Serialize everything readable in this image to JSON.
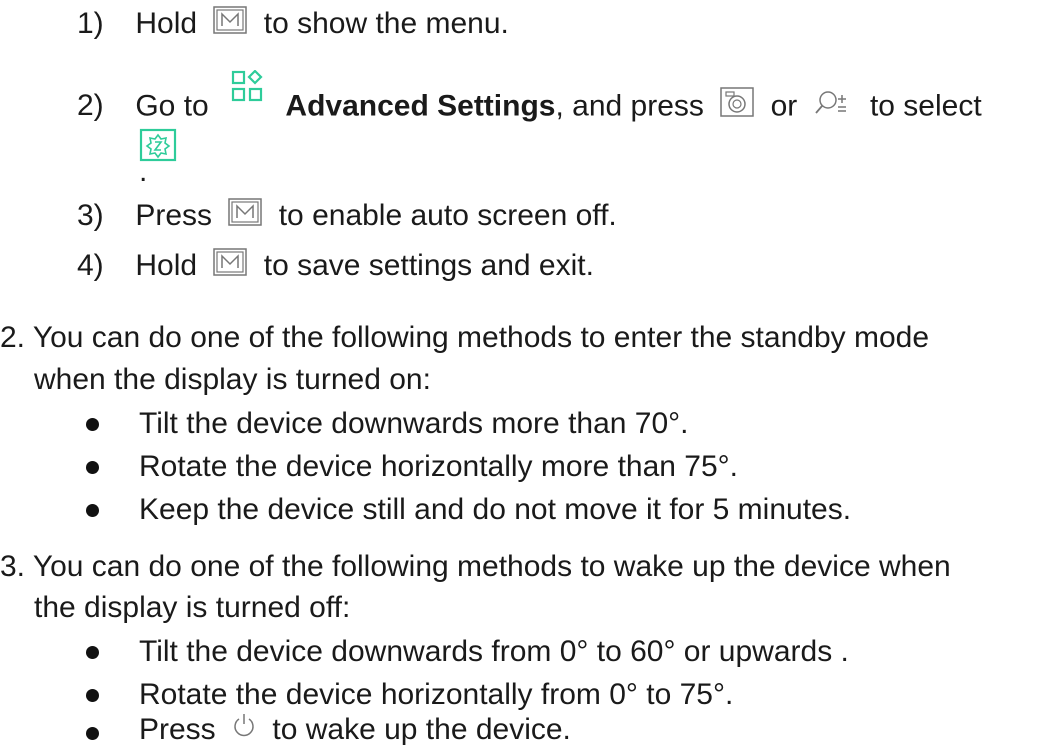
{
  "substeps": [
    {
      "num": "1)",
      "pre": "Hold",
      "post": "to show the menu."
    },
    {
      "num": "2)",
      "pre": "Go to",
      "bold": "Advanced Settings",
      "mid": ", and press",
      "or": "or",
      "post": "to select",
      "end": "."
    },
    {
      "num": "3)",
      "pre": "Press",
      "post": "to enable auto screen off."
    },
    {
      "num": "4)",
      "pre": "Hold",
      "post": "to save settings and exit."
    }
  ],
  "item2": {
    "num": "2.",
    "line1": "You can do one of the following methods to enter the standby mode",
    "line2": "when the display is turned on:",
    "bullets": [
      "Tilt the device downwards more than 70°.",
      "Rotate the device horizontally more than 75°.",
      "Keep the device still and do not move it for 5 minutes."
    ]
  },
  "item3": {
    "num": "3.",
    "line1": "You can do one of the following methods to wake up the device when",
    "line2": "the display is turned off:",
    "bullets": [
      "Tilt the device downwards from 0° to 60° or upwards .",
      "Rotate the device horizontally from 0° to 75°."
    ],
    "last_bullet": {
      "pre": "Press",
      "post": "to wake up the device."
    }
  },
  "icons": {
    "menu": "m-button-icon",
    "advanced": "advanced-settings-icon",
    "camera": "camera-button-icon",
    "zoom": "zoom-button-icon",
    "auto_screen": "auto-screen-off-icon",
    "power": "power-icon"
  },
  "colors": {
    "text": "#1a1a1a",
    "accent": "#2ecc9a"
  }
}
